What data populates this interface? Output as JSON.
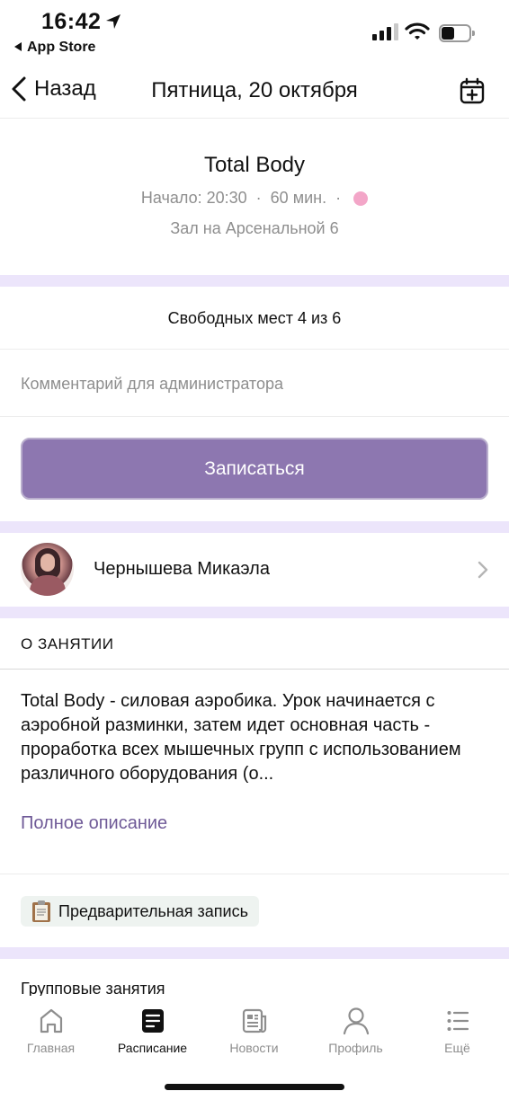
{
  "status_bar": {
    "time": "16:42",
    "back_app": "App Store",
    "battery_level": 0.45
  },
  "nav": {
    "back_label": "Назад",
    "title": "Пятница, 20 октября"
  },
  "class_info": {
    "title": "Total Body",
    "start": "Начало: 20:30",
    "duration": "60 мин.",
    "separator": "·",
    "place": "Зал на Арсенальной 6",
    "status_color": "#f3a6c8"
  },
  "booking": {
    "seats": "Свободных мест 4 из 6",
    "comment_placeholder": "Комментарий для администратора",
    "signup_label": "Записаться"
  },
  "trainer": {
    "name": "Чернышева Микаэла"
  },
  "about": {
    "label": "О ЗАНЯТИИ",
    "description": "Total Body - силовая аэробика. Урок начинается с аэробной разминки, затем идет основная часть - проработка всех мышечных групп с использованием различного оборудования (о...",
    "full_description_link": "Полное описание",
    "tag": "Предварительная запись",
    "group_label": "Групповые занятия"
  },
  "tabs": [
    {
      "label": "Главная",
      "icon": "home-icon"
    },
    {
      "label": "Расписание",
      "icon": "schedule-icon"
    },
    {
      "label": "Новости",
      "icon": "news-icon"
    },
    {
      "label": "Профиль",
      "icon": "profile-icon"
    },
    {
      "label": "Ещё",
      "icon": "more-icon"
    }
  ],
  "colors": {
    "accent": "#8d77b0",
    "link": "#6f5a97",
    "divider": "#ece5fb"
  }
}
